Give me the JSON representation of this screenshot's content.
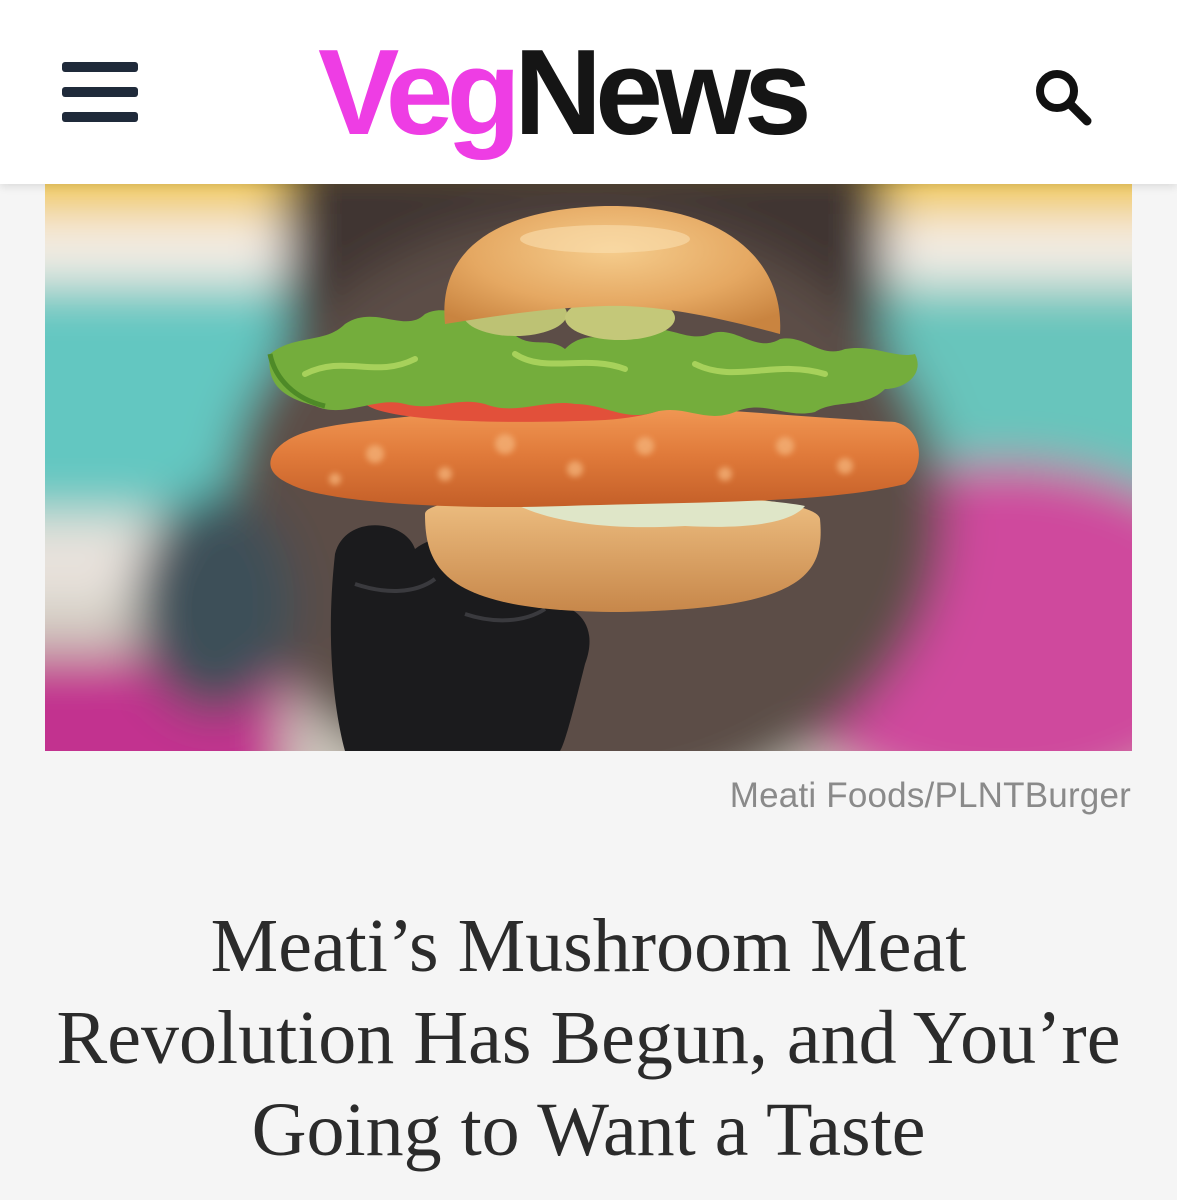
{
  "header": {
    "logo_part1": "Veg",
    "logo_part2": "News",
    "menu_icon": "hamburger-menu-icon",
    "search_icon": "search-icon",
    "brand_color": "#ee3de4"
  },
  "article": {
    "image_alt": "Crispy breaded mushroom cutlet sandwich with lettuce, tomato and pickles held by a black-gloved hand",
    "image_credit": "Meati Foods/PLNTBurger",
    "headline": "Meati’s Mushroom Meat Revolution Has Begun, and You’re Going to Want a Taste"
  }
}
